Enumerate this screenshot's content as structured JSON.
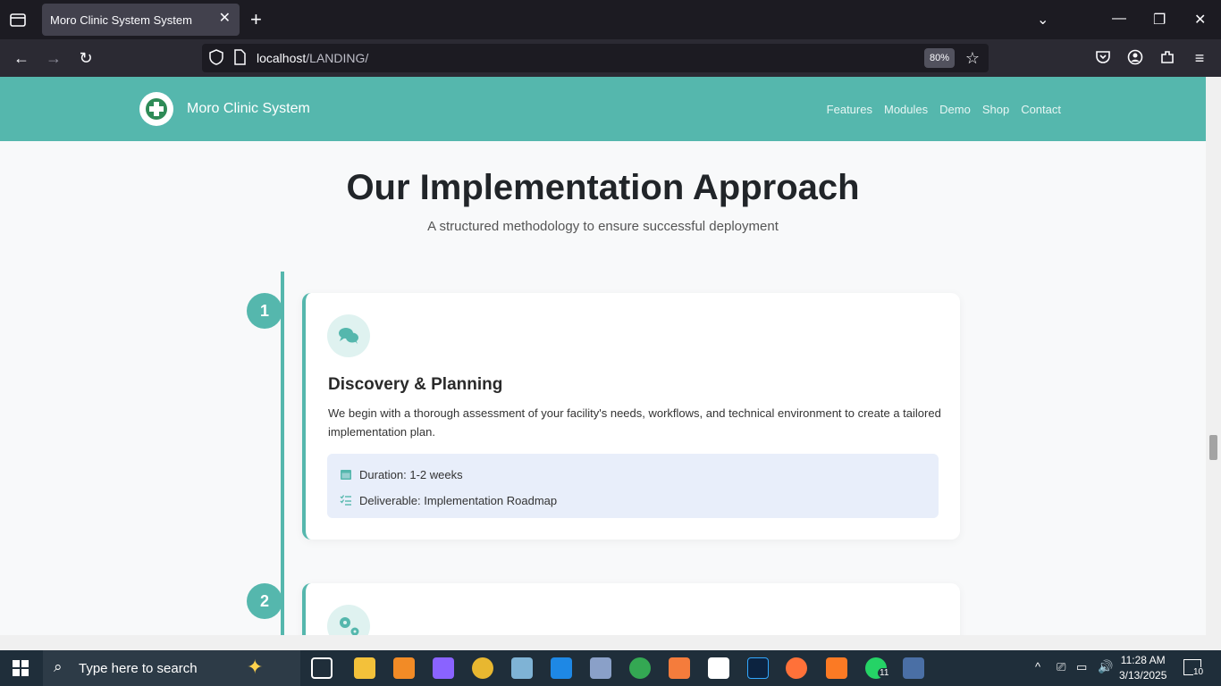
{
  "browser": {
    "tab_title": "Moro Clinic System System",
    "url_host": "localhost",
    "url_path": "/LANDING/",
    "zoom": "80%"
  },
  "site": {
    "brand": "Moro Clinic System",
    "nav": [
      "Features",
      "Modules",
      "Demo",
      "Shop",
      "Contact"
    ]
  },
  "section": {
    "title": "Our Implementation Approach",
    "subtitle": "A structured methodology to ensure successful deployment"
  },
  "steps": [
    {
      "number": "1",
      "icon": "comments-icon",
      "title": "Discovery & Planning",
      "description": "We begin with a thorough assessment of your facility's needs, workflows, and technical environment to create a tailored implementation plan.",
      "duration": "Duration: 1-2 weeks",
      "deliverable": "Deliverable: Implementation Roadmap"
    },
    {
      "number": "2",
      "icon": "cogs-icon"
    }
  ],
  "taskbar": {
    "search_placeholder": "Type here to search",
    "time": "11:28 AM",
    "date": "3/13/2025",
    "notifications": "10",
    "whatsapp_badge": "11"
  },
  "colors": {
    "accent": "#55b7ad",
    "header_bg": "#55b7ad",
    "info_bg": "#e8eefa"
  }
}
